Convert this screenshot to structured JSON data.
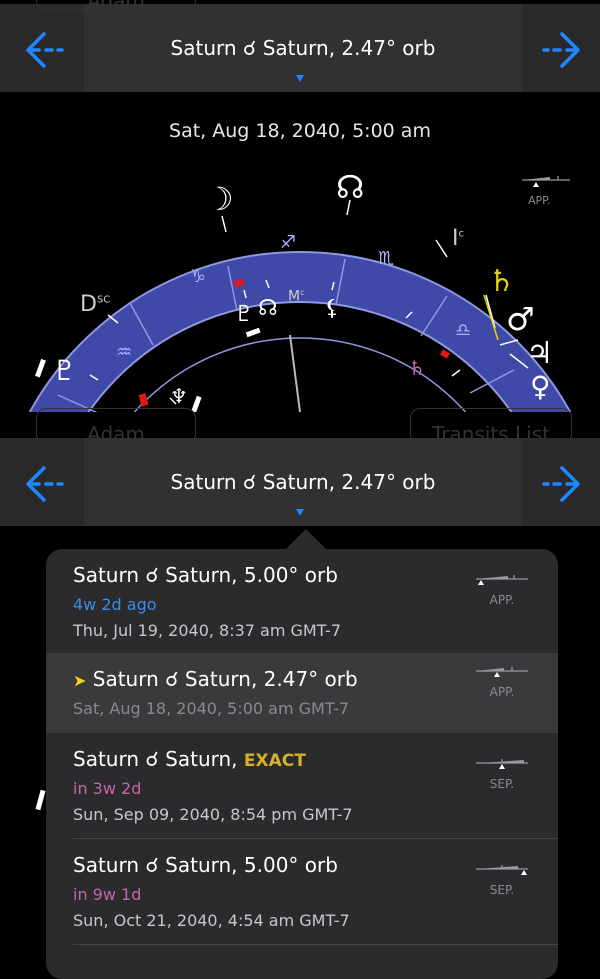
{
  "top_nav": {
    "title": "Saturn ☌ Saturn, 2.47° orb",
    "ghost_left": "Adam",
    "ghost_right": "Transits List"
  },
  "chart": {
    "date": "Sat, Aug 18, 2040, 5:00 am",
    "aspect_state": "APP.",
    "angle_dsc": "Dsc",
    "angle_mc": "Mc",
    "angle_ic": "Ic",
    "signs": [
      "♑",
      "♐",
      "♏",
      "♎",
      "♒"
    ],
    "planets_outer": [
      "☽",
      "☊",
      "♄",
      "♂",
      "♀",
      "♇"
    ],
    "planets_inner": [
      "♇",
      "☊",
      "⚸",
      "♄",
      "♆"
    ]
  },
  "bottom_nav": {
    "title": "Saturn ☌ Saturn, 2.47° orb",
    "ghost_left": "Adam",
    "ghost_right": "Transits List"
  },
  "popover": {
    "items": [
      {
        "title": "Saturn ☌ Saturn, 5.00° orb",
        "relative": "4w 2d ago",
        "date": "Thu, Jul 19, 2040, 8:37 am GMT-7",
        "state": "APP.",
        "relative_color": "#3a8ee6"
      },
      {
        "title": "Saturn ☌ Saturn, 2.47° orb",
        "date": "Sat, Aug 18, 2040, 5:00 am GMT-7",
        "state": "APP.",
        "selected_marker": "➤"
      },
      {
        "title": "Saturn ☌ Saturn, ",
        "exact": "EXACT",
        "relative": "in 3w 2d",
        "date": "Sun, Sep 09, 2040, 8:54 pm GMT-7",
        "state": "SEP.",
        "relative_color": "#c466a8"
      },
      {
        "title": "Saturn ☌ Saturn, 5.00° orb",
        "relative": "in 9w 1d",
        "date": "Sun, Oct 21, 2040, 4:54 am GMT-7",
        "state": "SEP.",
        "relative_color": "#c466a8"
      }
    ]
  },
  "colors": {
    "accent": "#1e88ff",
    "wheel_band": "#3f4aa8",
    "exact_gold": "#d6b22a",
    "saturn_transit": "#e8d400"
  }
}
